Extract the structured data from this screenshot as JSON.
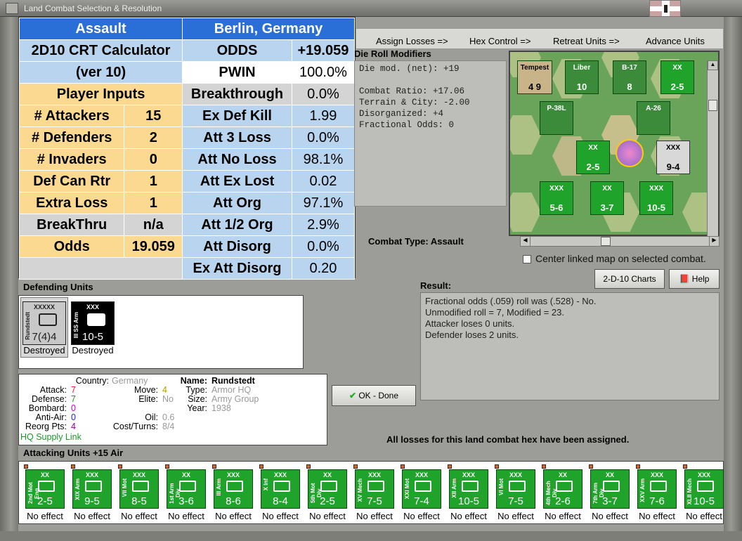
{
  "window": {
    "title": "Land Combat Selection & Resolution"
  },
  "crt": {
    "header_left": "Assault",
    "header_right": "Berlin, Germany",
    "calc_title": "2D10 CRT Calculator",
    "calc_version": "(ver 10)",
    "player_inputs": "Player Inputs",
    "inputs": [
      {
        "label": "# Attackers",
        "value": "15"
      },
      {
        "label": "# Defenders",
        "value": "2"
      },
      {
        "label": "# Invaders",
        "value": "0"
      },
      {
        "label": "Def Can Rtr",
        "value": "1"
      },
      {
        "label": "Extra Loss",
        "value": "1"
      },
      {
        "label": "BreakThru",
        "value": "n/a"
      },
      {
        "label": "Odds",
        "value": "19.059"
      }
    ],
    "outputs": [
      {
        "label": "ODDS",
        "value": "+19.059"
      },
      {
        "label": "PWIN",
        "value": "100.0%"
      },
      {
        "label": "Breakthrough",
        "value": "0.0%"
      },
      {
        "label": "Ex Def Kill",
        "value": "1.99"
      },
      {
        "label": "Att 3 Loss",
        "value": "0.0%"
      },
      {
        "label": "Att No Loss",
        "value": "98.1%"
      },
      {
        "label": "Att Ex Lost",
        "value": "0.02"
      },
      {
        "label": "Att Org",
        "value": "97.1%"
      },
      {
        "label": "Att 1/2 Org",
        "value": "2.9%"
      },
      {
        "label": "Att Disorg",
        "value": "0.0%"
      },
      {
        "label": "Ex Att Disorg",
        "value": "0.20"
      }
    ]
  },
  "links": [
    "Assign Losses =>",
    "Hex Control =>",
    "Retreat Units =>",
    "Advance Units"
  ],
  "die_mods": {
    "title": "Die Roll Modifiers",
    "lines": [
      "Die mod. (net): +19",
      "",
      "Combat Ratio: +17.06",
      "Terrain & City: -2.00",
      "Disorganized: +4",
      "Fractional Odds: 0"
    ]
  },
  "combat_type": "Combat Type:  Assault",
  "center_map": "Center linked map on selected combat.",
  "buttons": {
    "charts": "2-D-10 Charts",
    "help": "Help",
    "ok": "OK - Done"
  },
  "defending": {
    "title": "Defending Units",
    "units": [
      {
        "top": "XXXXX",
        "side": "Rundstedt",
        "value": "7(4)4",
        "caption": "Destroyed"
      },
      {
        "top": "XXX",
        "side": "III SS Arm",
        "value": "10-5",
        "caption": "Destroyed"
      }
    ]
  },
  "info": {
    "country_label": "Country:",
    "country": "Germany",
    "attack_label": "Attack:",
    "attack": "7",
    "defense_label": "Defense:",
    "defense": "7",
    "bombard_label": "Bombard:",
    "bombard": "0",
    "antiair_label": "Anti-Air:",
    "antiair": "0",
    "reorg_label": "Reorg Pts:",
    "reorg": "4",
    "hq_link": "HQ Supply Link",
    "move_label": "Move:",
    "move": "4",
    "elite_label": "Elite:",
    "elite": "No",
    "oil_label": "Oil:",
    "oil": "0.6",
    "cost_label": "Cost/Turns:",
    "cost": "8/4",
    "name_label": "Name:",
    "name": "Rundstedt",
    "type_label": "Type:",
    "type": "Armor HQ",
    "size_label": "Size:",
    "size": "Army Group",
    "year_label": "Year:",
    "year": "1938"
  },
  "result": {
    "title": "Result:",
    "lines": [
      "Fractional odds (.059) roll was (.528)  - No.",
      "Unmodified roll = 7, Modified = 23.",
      "Attacker loses 0 units.",
      "Defender loses 2 units."
    ]
  },
  "all_losses": "All losses for this land combat hex have been assigned.",
  "attacking": {
    "title": "Attacking Units +15 Air",
    "units": [
      {
        "top": "XX",
        "side": "2nd Mot Eng",
        "value": "2-5",
        "caption": "No effect"
      },
      {
        "top": "XXX",
        "side": "XIX Arm",
        "value": "9-5",
        "caption": "No effect"
      },
      {
        "top": "XXX",
        "side": "VII Mot",
        "value": "8-5",
        "caption": "No effect"
      },
      {
        "top": "XX",
        "side": "1st Arm Div",
        "value": "3-6",
        "caption": "No effect"
      },
      {
        "top": "XXX",
        "side": "III Arm",
        "value": "8-6",
        "caption": "No effect"
      },
      {
        "top": "XXX",
        "side": "X Inf",
        "value": "8-4",
        "caption": "No effect"
      },
      {
        "top": "XX",
        "side": "5th Mot Div",
        "value": "2-5",
        "caption": "No effect"
      },
      {
        "top": "XXX",
        "side": "XV Mech",
        "value": "7-5",
        "caption": "No effect"
      },
      {
        "top": "XXX",
        "side": "XXI Mot",
        "value": "7-4",
        "caption": "No effect"
      },
      {
        "top": "XXX",
        "side": "XII Arm",
        "value": "10-5",
        "caption": "No effect"
      },
      {
        "top": "XXX",
        "side": "VI Mot",
        "value": "7-5",
        "caption": "No effect"
      },
      {
        "top": "XX",
        "side": "4th Mech Div",
        "value": "2-6",
        "caption": "No effect"
      },
      {
        "top": "XX",
        "side": "7th Arm Div",
        "value": "3-7",
        "caption": "No effect"
      },
      {
        "top": "XXX",
        "side": "XXV Arm",
        "value": "7-6",
        "caption": "No effect"
      },
      {
        "top": "XXX",
        "side": "XLII Mech",
        "value": "10-5",
        "caption": "No effect"
      }
    ]
  },
  "map": {
    "counters": [
      {
        "label": "Tempest",
        "value": "4 9"
      },
      {
        "label": "Liber",
        "value": "10"
      },
      {
        "label": "B-17",
        "value": "8"
      },
      {
        "label": "XX",
        "value": "2-5"
      },
      {
        "label": "P-38L",
        "value": ""
      },
      {
        "label": "A-26",
        "value": ""
      },
      {
        "label": "XXX",
        "value": "9-4"
      },
      {
        "label": "XXX",
        "value": "5-6"
      },
      {
        "label": "XX",
        "value": "3-7"
      },
      {
        "label": "XXX",
        "value": "10-5"
      },
      {
        "label": "XX",
        "value": "2-5"
      }
    ]
  },
  "colors": {
    "header_blue": "#2a6ed8",
    "light_blue": "#b8d4ee",
    "yellow": "#fcd990",
    "unit_green": "#1fa32a",
    "black_unit": "#000000"
  }
}
